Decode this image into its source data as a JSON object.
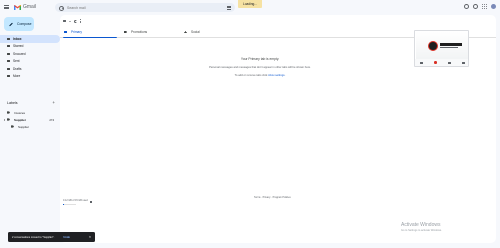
{
  "app": {
    "name": "Gmail"
  },
  "header": {
    "search_placeholder": "Search mail",
    "loading_text": "Loading..."
  },
  "sidebar": {
    "compose_label": "Compose",
    "nav": [
      {
        "label": "Inbox"
      },
      {
        "label": "Starred"
      },
      {
        "label": "Snoozed"
      },
      {
        "label": "Sent"
      },
      {
        "label": "Drafts"
      },
      {
        "label": "More"
      }
    ],
    "labels_heading": "Labels",
    "labels": [
      {
        "label": "Invoices"
      },
      {
        "label": "Supplier",
        "count": "274"
      },
      {
        "label": "Supplier"
      }
    ]
  },
  "tabs": [
    {
      "label": "Primary"
    },
    {
      "label": "Promotions"
    },
    {
      "label": "Social"
    }
  ],
  "empty_state": {
    "title": "Your Primary tab is empty.",
    "description": "Personal messages and messages that don't appear in other tabs will be shown here.",
    "link_prefix": "To add or remove tabs click ",
    "link_text": "inbox settings",
    "link_suffix": "."
  },
  "footer": {
    "storage_text": "0.12 GB of 15 GB used",
    "storage_fraction": 0.01,
    "links": "Terms · Privacy · Program Policies"
  },
  "watermark": {
    "title": "Activate Windows",
    "subtitle": "Go to Settings to activate Windows."
  },
  "snackbar": {
    "message": "2 conversations moved to \"Supplier\".",
    "undo_label": "Undo"
  },
  "colors": {
    "accent": "#0b57d0",
    "compose_bg": "#c2e7ff",
    "active_nav_bg": "#d3e3fd",
    "loading_bg": "#f6e2a3",
    "snackbar_bg": "#202124"
  }
}
